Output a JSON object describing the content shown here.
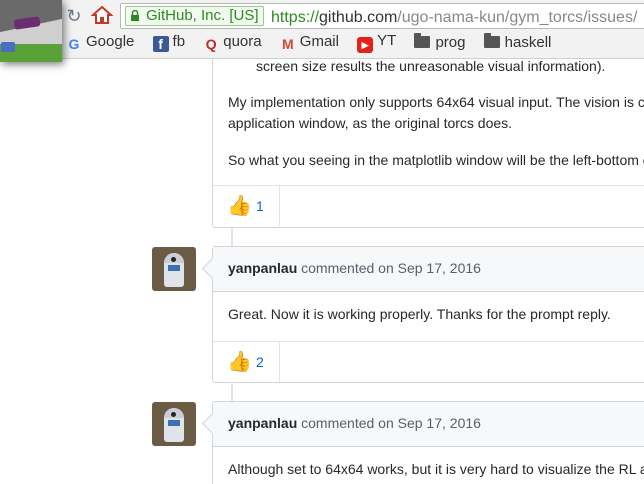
{
  "browser": {
    "ev_label": "GitHub, Inc. [US]",
    "url_scheme": "https://",
    "url_host": "github.com",
    "url_path": "/ugo-nama-kun/gym_torcs/issues/"
  },
  "bookmarks": [
    {
      "label": "Google",
      "icon": "google-g-icon"
    },
    {
      "label": "fb",
      "icon": "facebook-icon"
    },
    {
      "label": "quora",
      "icon": "quora-icon"
    },
    {
      "label": "Gmail",
      "icon": "gmail-icon"
    },
    {
      "label": "YT",
      "icon": "youtube-icon"
    },
    {
      "label": "prog",
      "icon": "folder-icon"
    },
    {
      "label": "haskell",
      "icon": "folder-icon"
    }
  ],
  "comment1": {
    "lines": [
      "screen size results the unreasonable visual information).",
      "My implementation only supports 64x64 visual input. The vision is c",
      "application window, as the original torcs does.",
      "So what you seeing in the matplotlib window will be the left-bottom c"
    ],
    "reaction_count": "1"
  },
  "comment2": {
    "author": "yanpanlau",
    "meta": "commented on Sep 17, 2016",
    "text": "Great. Now it is working properly. Thanks for the prompt reply.",
    "reaction_count": "2"
  },
  "comment3": {
    "author": "yanpanlau",
    "meta": "commented on Sep 17, 2016",
    "text": "Although set to 64x64 works, but it is very hard to visualize the RL a"
  },
  "colors": {
    "link": "#0366d6",
    "ev_green": "#2d8a22"
  }
}
